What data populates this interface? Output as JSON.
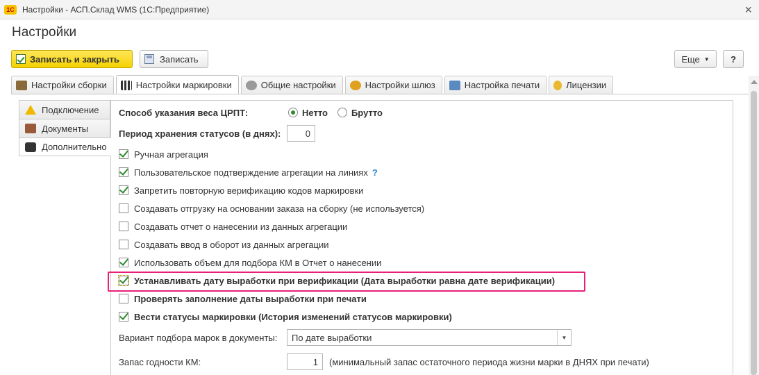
{
  "window": {
    "logo": "1С",
    "title": "Настройки - АСП.Склад WMS  (1С:Предприятие)"
  },
  "page_title": "Настройки",
  "toolbar": {
    "save_close_label": "Записать и закрыть",
    "save_label": "Записать",
    "more_label": "Еще",
    "help_label": "?"
  },
  "tabs": [
    {
      "label": "Настройки сборки",
      "icon": "assembly-settings-icon",
      "color": "#8a6a3a"
    },
    {
      "label": "Настройки маркировки",
      "icon": "qr-code-icon",
      "color": "#333333"
    },
    {
      "label": "Общие настройки",
      "icon": "gear-icon",
      "color": "#7a7a7a"
    },
    {
      "label": "Настройки шлюз",
      "icon": "gateway-icon",
      "color": "#e0a020"
    },
    {
      "label": "Настройка печати",
      "icon": "printer-icon",
      "color": "#5a8ac0"
    },
    {
      "label": "Лицензии",
      "icon": "license-icon",
      "color": "#e8b830"
    }
  ],
  "sidebar": [
    {
      "label": "Подключение",
      "icon": "warning-icon"
    },
    {
      "label": "Документы",
      "icon": "briefcase-icon"
    },
    {
      "label": "Дополнительно",
      "icon": "chat-icon"
    }
  ],
  "form": {
    "weight_method_label": "Способ указания веса ЦРПТ:",
    "weight_net": "Нетто",
    "weight_gross": "Брутто",
    "weight_selected": "Нетто",
    "storage_period_label": "Период хранения статусов (в днях):",
    "storage_period_value": "0",
    "checkboxes": [
      {
        "label": "Ручная агрегация",
        "checked": true,
        "bold": false
      },
      {
        "label": "Пользовательское подтверждение агрегации на линиях",
        "checked": true,
        "bold": false,
        "help": "?"
      },
      {
        "label": "Запретить повторную верификацию кодов маркировки",
        "checked": true,
        "bold": false
      },
      {
        "label": "Создавать отгрузку на основании заказа на сборку (не используется)",
        "checked": false,
        "bold": false
      },
      {
        "label": "Создавать отчет о нанесении из данных агрегации",
        "checked": false,
        "bold": false
      },
      {
        "label": "Создавать ввод в оборот из данных агрегации",
        "checked": false,
        "bold": false
      },
      {
        "label": "Использовать объем для подбора КМ в Отчет о нанесении",
        "checked": true,
        "bold": false
      },
      {
        "label": "Устанавливать дату выработки при верификации (Дата выработки равна дате верификации)",
        "checked": true,
        "bold": true
      },
      {
        "label": "Проверять заполнение даты выработки при печати",
        "checked": false,
        "bold": true
      },
      {
        "label": "Вести статусы маркировки (История изменений статусов маркировки)",
        "checked": true,
        "bold": true
      }
    ],
    "marks_variant_label": "Вариант подбора марок в документы:",
    "marks_variant_value": "По дате выработки",
    "km_reserve_label": "Запас годности КМ:",
    "km_reserve_value": "1",
    "km_reserve_hint": "(минимальный запас остаточного периода жизни марки в ДНЯХ при печати)"
  },
  "colors": {
    "primary_button": "#f5d200",
    "highlight": "#e8207a",
    "check": "#2d8a2d"
  }
}
